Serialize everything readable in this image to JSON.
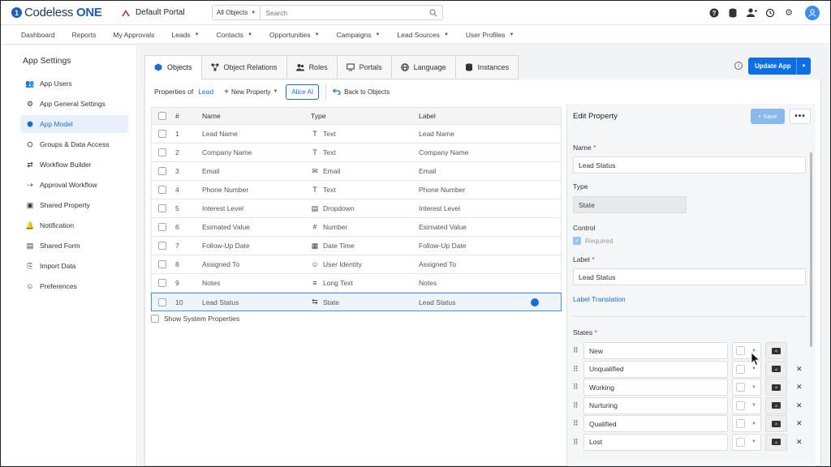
{
  "brand": {
    "name_prefix": "Codeless",
    "name_suffix": "ONE",
    "mark": "1"
  },
  "portal": {
    "name": "Default Portal"
  },
  "search": {
    "scope": "All Objects",
    "placeholder": "Search"
  },
  "nav": [
    {
      "label": "Dashboard",
      "dropdown": false
    },
    {
      "label": "Reports",
      "dropdown": false
    },
    {
      "label": "My Approvals",
      "dropdown": false
    },
    {
      "label": "Leads",
      "dropdown": true
    },
    {
      "label": "Contacts",
      "dropdown": true
    },
    {
      "label": "Opportunities",
      "dropdown": true
    },
    {
      "label": "Campaigns",
      "dropdown": true
    },
    {
      "label": "Lead Sources",
      "dropdown": true
    },
    {
      "label": "User Profiles",
      "dropdown": true
    }
  ],
  "sidebar": {
    "title": "App Settings",
    "items": [
      {
        "label": "App Users",
        "icon": "users-icon"
      },
      {
        "label": "App General Settings",
        "icon": "gear-icon"
      },
      {
        "label": "App Model",
        "icon": "cube-icon",
        "active": true
      },
      {
        "label": "Groups & Data Access",
        "icon": "group-icon"
      },
      {
        "label": "Workflow Builder",
        "icon": "workflow-icon"
      },
      {
        "label": "Approval Workflow",
        "icon": "approval-icon"
      },
      {
        "label": "Shared Property",
        "icon": "shared-property-icon"
      },
      {
        "label": "Notification",
        "icon": "bell-icon"
      },
      {
        "label": "Shared Form",
        "icon": "form-icon"
      },
      {
        "label": "Import Data",
        "icon": "import-icon"
      },
      {
        "label": "Preferences",
        "icon": "preferences-icon"
      }
    ]
  },
  "tabs": [
    {
      "label": "Objects",
      "active": true
    },
    {
      "label": "Object Relations"
    },
    {
      "label": "Roles"
    },
    {
      "label": "Portals"
    },
    {
      "label": "Language"
    },
    {
      "label": "Instances"
    }
  ],
  "update_button": "Update App",
  "properties_bar": {
    "prefix": "Properties of",
    "object": "Lead",
    "new_property": "New Property",
    "alice": "Alice AI",
    "back": "Back to Objects"
  },
  "table": {
    "headers": {
      "num": "#",
      "name": "Name",
      "type": "Type",
      "label": "Label"
    },
    "rows": [
      {
        "num": "1",
        "name": "Lead Name",
        "type": "Text",
        "type_glyph": "T",
        "label": "Lead Name"
      },
      {
        "num": "2",
        "name": "Company Name",
        "type": "Text",
        "type_glyph": "T",
        "label": "Company Name"
      },
      {
        "num": "3",
        "name": "Email",
        "type": "Email",
        "type_glyph": "✉",
        "label": "Email"
      },
      {
        "num": "4",
        "name": "Phone Number",
        "type": "Text",
        "type_glyph": "T",
        "label": "Phone Number"
      },
      {
        "num": "5",
        "name": "Interest Level",
        "type": "Dropdown",
        "type_glyph": "▤",
        "label": "Interest Level"
      },
      {
        "num": "6",
        "name": "Esimated Value",
        "type": "Number",
        "type_glyph": "#",
        "label": "Esimated Value"
      },
      {
        "num": "7",
        "name": "Follow-Up Date",
        "type": "Date Time",
        "type_glyph": "▦",
        "label": "Follow-Up Date"
      },
      {
        "num": "8",
        "name": "Assigned To",
        "type": "User Identity",
        "type_glyph": "☺",
        "label": "Assigned To"
      },
      {
        "num": "9",
        "name": "Notes",
        "type": "Long Text",
        "type_glyph": "≡",
        "label": "Notes"
      },
      {
        "num": "10",
        "name": "Lead Status",
        "type": "State",
        "type_glyph": "⇆",
        "label": "Lead Status",
        "selected": true
      }
    ],
    "show_system": "Show System Properties"
  },
  "edit": {
    "title": "Edit Property",
    "save": "Save",
    "name_label": "Name",
    "name_value": "Lead Status",
    "type_label": "Type",
    "type_value": "State",
    "control_label": "Control",
    "required_label": "Required",
    "label_label": "Label",
    "label_value": "Lead Status",
    "label_translation": "Label Translation",
    "states_label": "States",
    "states": [
      "New",
      "Unqualified",
      "Working",
      "Nurturing",
      "Qualified",
      "Lost"
    ]
  }
}
